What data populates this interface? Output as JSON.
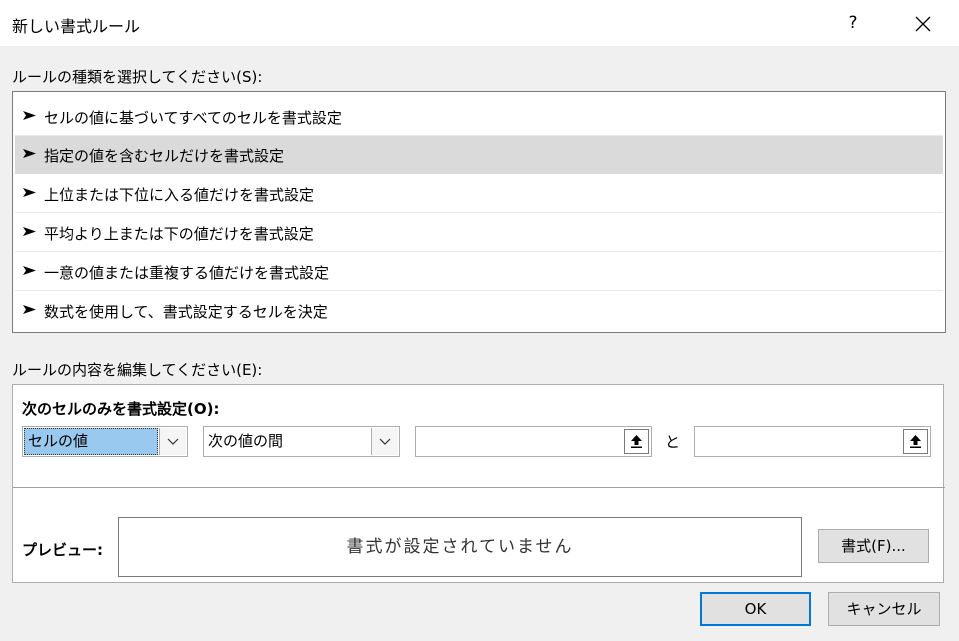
{
  "dialog": {
    "title": "新しい書式ルール",
    "help": "?"
  },
  "rule_type": {
    "label": "ルールの種類を選択してください(S):",
    "items": [
      "セルの値に基づいてすべてのセルを書式設定",
      "指定の値を含むセルだけを書式設定",
      "上位または下位に入る値だけを書式設定",
      "平均より上または下の値だけを書式設定",
      "一意の値または重複する値だけを書式設定",
      "数式を使用して、書式設定するセルを決定"
    ],
    "selected_index": 1
  },
  "edit": {
    "label": "ルールの内容を編集してください(E):",
    "format_only_label": "次のセルのみを書式設定(O):",
    "condition_type": "セルの値",
    "operator": "次の値の間",
    "value1": "",
    "and_label": "と",
    "value2": "",
    "preview_label": "プレビュー:",
    "preview_text": "書式が設定されていません",
    "format_button": "書式(F)..."
  },
  "footer": {
    "ok": "OK",
    "cancel": "キャンセル"
  },
  "colors": {
    "selection": "#dadada",
    "highlight": "#99c9ef",
    "default_button_border": "#0078d7"
  }
}
